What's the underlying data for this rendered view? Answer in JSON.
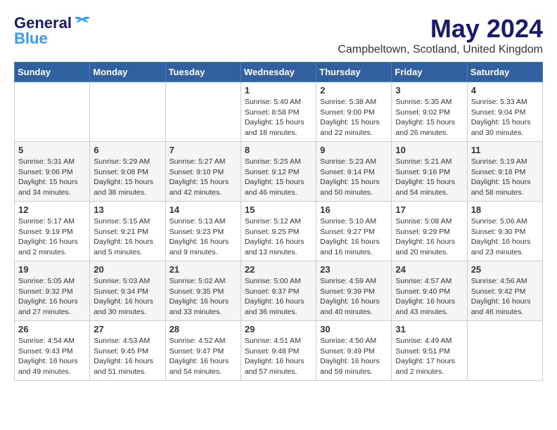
{
  "header": {
    "logo_general": "General",
    "logo_blue": "Blue",
    "title": "May 2024",
    "location": "Campbeltown, Scotland, United Kingdom"
  },
  "weekdays": [
    "Sunday",
    "Monday",
    "Tuesday",
    "Wednesday",
    "Thursday",
    "Friday",
    "Saturday"
  ],
  "weeks": [
    [
      {
        "day": "",
        "content": ""
      },
      {
        "day": "",
        "content": ""
      },
      {
        "day": "",
        "content": ""
      },
      {
        "day": "1",
        "content": "Sunrise: 5:40 AM\nSunset: 8:58 PM\nDaylight: 15 hours\nand 18 minutes."
      },
      {
        "day": "2",
        "content": "Sunrise: 5:38 AM\nSunset: 9:00 PM\nDaylight: 15 hours\nand 22 minutes."
      },
      {
        "day": "3",
        "content": "Sunrise: 5:35 AM\nSunset: 9:02 PM\nDaylight: 15 hours\nand 26 minutes."
      },
      {
        "day": "4",
        "content": "Sunrise: 5:33 AM\nSunset: 9:04 PM\nDaylight: 15 hours\nand 30 minutes."
      }
    ],
    [
      {
        "day": "5",
        "content": "Sunrise: 5:31 AM\nSunset: 9:06 PM\nDaylight: 15 hours\nand 34 minutes."
      },
      {
        "day": "6",
        "content": "Sunrise: 5:29 AM\nSunset: 9:08 PM\nDaylight: 15 hours\nand 38 minutes."
      },
      {
        "day": "7",
        "content": "Sunrise: 5:27 AM\nSunset: 9:10 PM\nDaylight: 15 hours\nand 42 minutes."
      },
      {
        "day": "8",
        "content": "Sunrise: 5:25 AM\nSunset: 9:12 PM\nDaylight: 15 hours\nand 46 minutes."
      },
      {
        "day": "9",
        "content": "Sunrise: 5:23 AM\nSunset: 9:14 PM\nDaylight: 15 hours\nand 50 minutes."
      },
      {
        "day": "10",
        "content": "Sunrise: 5:21 AM\nSunset: 9:16 PM\nDaylight: 15 hours\nand 54 minutes."
      },
      {
        "day": "11",
        "content": "Sunrise: 5:19 AM\nSunset: 9:18 PM\nDaylight: 15 hours\nand 58 minutes."
      }
    ],
    [
      {
        "day": "12",
        "content": "Sunrise: 5:17 AM\nSunset: 9:19 PM\nDaylight: 16 hours\nand 2 minutes."
      },
      {
        "day": "13",
        "content": "Sunrise: 5:15 AM\nSunset: 9:21 PM\nDaylight: 16 hours\nand 5 minutes."
      },
      {
        "day": "14",
        "content": "Sunrise: 5:13 AM\nSunset: 9:23 PM\nDaylight: 16 hours\nand 9 minutes."
      },
      {
        "day": "15",
        "content": "Sunrise: 5:12 AM\nSunset: 9:25 PM\nDaylight: 16 hours\nand 13 minutes."
      },
      {
        "day": "16",
        "content": "Sunrise: 5:10 AM\nSunset: 9:27 PM\nDaylight: 16 hours\nand 16 minutes."
      },
      {
        "day": "17",
        "content": "Sunrise: 5:08 AM\nSunset: 9:29 PM\nDaylight: 16 hours\nand 20 minutes."
      },
      {
        "day": "18",
        "content": "Sunrise: 5:06 AM\nSunset: 9:30 PM\nDaylight: 16 hours\nand 23 minutes."
      }
    ],
    [
      {
        "day": "19",
        "content": "Sunrise: 5:05 AM\nSunset: 9:32 PM\nDaylight: 16 hours\nand 27 minutes."
      },
      {
        "day": "20",
        "content": "Sunrise: 5:03 AM\nSunset: 9:34 PM\nDaylight: 16 hours\nand 30 minutes."
      },
      {
        "day": "21",
        "content": "Sunrise: 5:02 AM\nSunset: 9:35 PM\nDaylight: 16 hours\nand 33 minutes."
      },
      {
        "day": "22",
        "content": "Sunrise: 5:00 AM\nSunset: 9:37 PM\nDaylight: 16 hours\nand 36 minutes."
      },
      {
        "day": "23",
        "content": "Sunrise: 4:59 AM\nSunset: 9:39 PM\nDaylight: 16 hours\nand 40 minutes."
      },
      {
        "day": "24",
        "content": "Sunrise: 4:57 AM\nSunset: 9:40 PM\nDaylight: 16 hours\nand 43 minutes."
      },
      {
        "day": "25",
        "content": "Sunrise: 4:56 AM\nSunset: 9:42 PM\nDaylight: 16 hours\nand 46 minutes."
      }
    ],
    [
      {
        "day": "26",
        "content": "Sunrise: 4:54 AM\nSunset: 9:43 PM\nDaylight: 16 hours\nand 49 minutes."
      },
      {
        "day": "27",
        "content": "Sunrise: 4:53 AM\nSunset: 9:45 PM\nDaylight: 16 hours\nand 51 minutes."
      },
      {
        "day": "28",
        "content": "Sunrise: 4:52 AM\nSunset: 9:47 PM\nDaylight: 16 hours\nand 54 minutes."
      },
      {
        "day": "29",
        "content": "Sunrise: 4:51 AM\nSunset: 9:48 PM\nDaylight: 16 hours\nand 57 minutes."
      },
      {
        "day": "30",
        "content": "Sunrise: 4:50 AM\nSunset: 9:49 PM\nDaylight: 16 hours\nand 59 minutes."
      },
      {
        "day": "31",
        "content": "Sunrise: 4:49 AM\nSunset: 9:51 PM\nDaylight: 17 hours\nand 2 minutes."
      },
      {
        "day": "",
        "content": ""
      }
    ]
  ]
}
